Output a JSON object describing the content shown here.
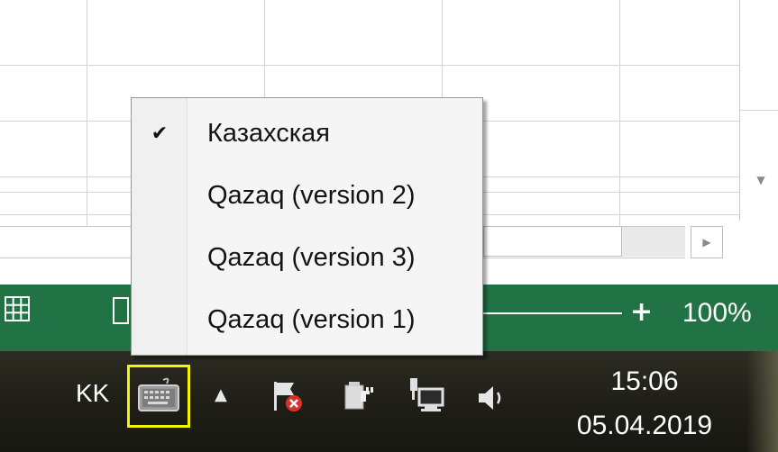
{
  "status_bar": {
    "zoom_level": "100%",
    "zoom_plus": "+"
  },
  "language_menu": {
    "items": [
      {
        "label": "Казахская",
        "checked": true,
        "check_glyph": "✔"
      },
      {
        "label": "Qazaq (version 2)",
        "checked": false,
        "check_glyph": ""
      },
      {
        "label": "Qazaq (version 3)",
        "checked": false,
        "check_glyph": ""
      },
      {
        "label": "Qazaq (version 1)",
        "checked": false,
        "check_glyph": ""
      }
    ]
  },
  "taskbar": {
    "language_code": "KK",
    "keyboard_icon": "keyboard-icon",
    "highlight_color": "#f5f500",
    "clock": {
      "time": "15:06",
      "date": "05.04.2019"
    },
    "tray_icons": [
      "show-hidden-icons-arrow-icon",
      "action-center-flag-icon",
      "power-plug-icon",
      "network-icon",
      "volume-icon"
    ]
  },
  "colors": {
    "excel_green": "#217346",
    "taskbar_dark": "#1e1e17"
  }
}
